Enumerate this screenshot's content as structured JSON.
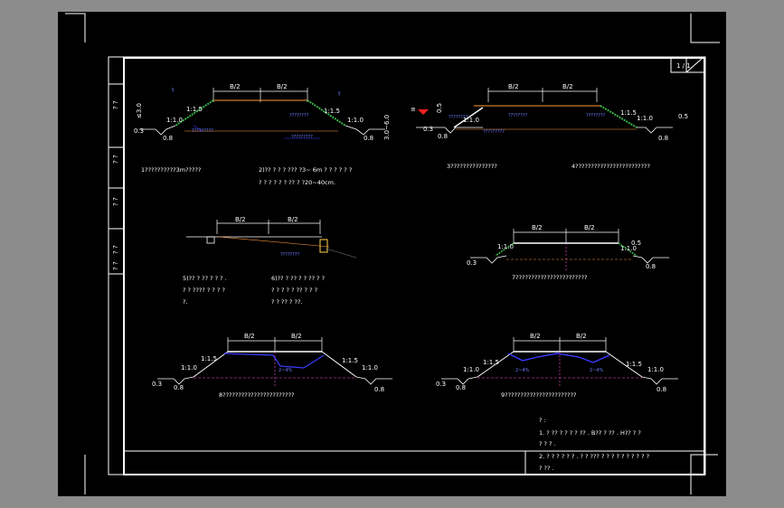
{
  "title_block": {
    "sheet_label": "1 / 1"
  },
  "side_labels": [
    "? ?",
    "? ?",
    "? ?",
    "? ?",
    "? ?"
  ],
  "dimensions": {
    "half_width": "B/2",
    "slope": "1:1.5",
    "slope_1": "1:1.0",
    "depth_03": "0.3",
    "depth_08": "0.8",
    "depth_05": "0.5",
    "height_30": "≤3.0",
    "height_range": "3.0~6.0",
    "crossfall": "2~4%"
  },
  "figure_captions": {
    "fig1": "1??????????3m?????",
    "fig2_line1": "2)?? ? ? ? ??? ?3~ 6m ? ? ? ? ? ?",
    "fig2_line2": "? ? ? ? ? ? ?? ? ?20~40cm.",
    "fig3": "3???????????????",
    "fig4": "4????????????????????????",
    "fig5_line1": "5)?? ? ?? ? ? ? .",
    "fig5_line2": "? ? ???? ? ? ? ?",
    "fig5_line3": "?.",
    "fig6_line1": "6)?? ? ?? ? ? ?? ? ?",
    "fig6_line2": "? ? ? ? ? ?? ? ? ?",
    "fig6_line3": "? ? ?? ? ??.",
    "fig7": "7???????????????????????",
    "fig8": "8???????????????????????",
    "fig9": "9???????????????????????"
  },
  "blue_labels": {
    "a": "?????????",
    "b": "????????",
    "c": "?????????",
    "d": "????????"
  },
  "notes": {
    "heading": "? :",
    "line1": "1. ? ?? ? ? ? ? ?? . B?? ? ?? . H?? ? ?",
    "line2": "? ? ? .",
    "line3": "2. ? ? ? ? ? ? . ? ? ??? ? ? ? ? ? ? ? ? ? ?",
    "line4": "? ?? ."
  },
  "colors": {
    "frame": "#ffffff",
    "ground": "#ff9a3c",
    "grass": "#39b54a",
    "water": "#3a3aff",
    "marker": "#ff2020"
  }
}
